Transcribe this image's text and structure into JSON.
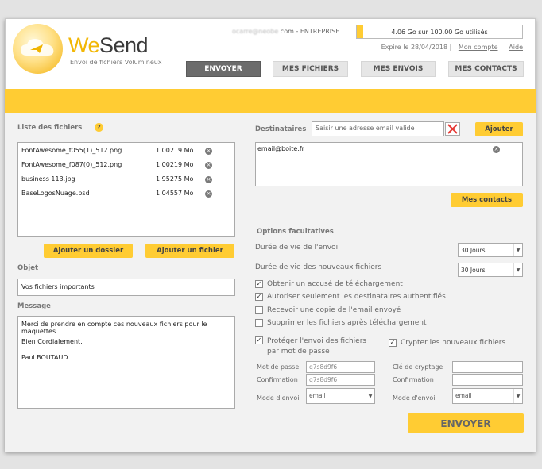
{
  "brand": {
    "name_part1": "We",
    "name_part2": "Send",
    "tagline": "Envoi de fichiers Volumineux"
  },
  "account": {
    "email_masked": "ocarre@neobe",
    "email_suffix": ".com - ENTREPRISE",
    "quota_text": "4.06 Go sur 100.00 Go utilisés",
    "quota_used_fraction": 0.0406,
    "expire_text": "Expire le 28/04/2018",
    "my_account_link": "Mon compte",
    "help_link": "Aide"
  },
  "nav": {
    "send": "ENVOYER",
    "my_files": "MES FICHIERS",
    "my_sends": "MES ENVOIS",
    "my_contacts": "MES CONTACTS"
  },
  "files": {
    "heading": "Liste des fichiers",
    "help_symbol": "?",
    "items": [
      {
        "name": "FontAwesome_f055(1)_512.png",
        "size": "1.00219 Mo"
      },
      {
        "name": "FontAwesome_f087(0)_512.png",
        "size": "1.00219 Mo"
      },
      {
        "name": "business 113.jpg",
        "size": "1.95275 Mo"
      },
      {
        "name": "BaseLogosNuage.psd",
        "size": "1.04557 Mo"
      }
    ],
    "remove_symbol": "×",
    "add_folder_label": "Ajouter un dossier",
    "add_file_label": "Ajouter un fichier"
  },
  "subject": {
    "heading": "Objet",
    "value": "Vos fichiers importants"
  },
  "message": {
    "heading": "Message",
    "lines": [
      "Merci de prendre en compte ces nouveaux fichiers pour le maquettes.",
      "Bien Cordialement.",
      "Paul BOUTAUD."
    ]
  },
  "recipients": {
    "heading": "Destinataires",
    "placeholder": "Saisir une adresse email valide",
    "add_label": "Ajouter",
    "list": [
      "email@boite.fr"
    ],
    "contacts_label": "Mes contacts"
  },
  "options": {
    "heading": "Options facultatives",
    "send_lifetime_label": "Durée de vie de l'envoi",
    "send_lifetime_value": "30 Jours",
    "files_lifetime_label": "Durée de vie des nouveaux fichiers",
    "files_lifetime_value": "30 Jours",
    "checkboxes": [
      {
        "label": "Obtenir un accusé de téléchargement",
        "checked": true
      },
      {
        "label": "Autoriser seulement les destinataires authentifiés",
        "checked": true
      },
      {
        "label": "Recevoir une copie de l'email envoyé",
        "checked": false
      },
      {
        "label": "Supprimer les fichiers après téléchargement",
        "checked": false
      }
    ],
    "protect_label_line1": "Protéger l'envoi des fichiers",
    "protect_label_line2": "par mot de passe",
    "protect_checked": true,
    "encrypt_label": "Crypter les nouveaux fichiers",
    "encrypt_checked": true,
    "password_label": "Mot de passe",
    "password_value": "q7s8d9f6",
    "confirm_label": "Confirmation",
    "confirm_value": "q7s8d9f6",
    "send_mode_label": "Mode d'envoi",
    "send_mode_value": "email",
    "crypt_key_label": "Clé de cryptage",
    "crypt_confirm_label": "Confirmation",
    "crypt_send_mode_label": "Mode d'envoi",
    "crypt_send_mode_value": "email"
  },
  "submit_label": "ENVOYER",
  "check_symbol": "✓",
  "colors": {
    "accent": "#ffcc33",
    "nav_active": "#6c6c6c",
    "clear_x": "#e53935"
  }
}
